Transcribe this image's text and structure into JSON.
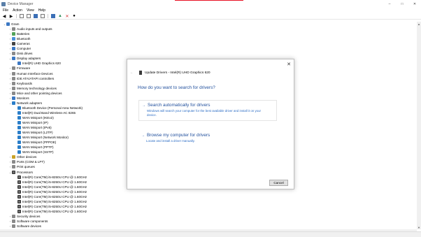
{
  "window": {
    "title": "Device Manager",
    "buttons": {
      "minimize": "–",
      "maximize": "□",
      "close": "✕"
    }
  },
  "menu": [
    "File",
    "Action",
    "View",
    "Help"
  ],
  "toolbar": [
    "back-arrow-icon",
    "forward-arrow-icon",
    "view-icon",
    "properties-icon",
    "help-icon",
    "list-icon",
    "monitor-icon",
    "update-driver-icon",
    "uninstall-icon",
    "scan-hardware-icon"
  ],
  "tree": [
    {
      "label": "Gram",
      "level": 0,
      "exp": "⌄",
      "icon": "computer"
    },
    {
      "label": "Audio inputs and outputs",
      "level": 1,
      "exp": "›",
      "icon": "gray"
    },
    {
      "label": "Batteries",
      "level": 1,
      "exp": "›",
      "icon": "green"
    },
    {
      "label": "Bluetooth",
      "level": 1,
      "exp": "›",
      "icon": "blue"
    },
    {
      "label": "Cameras",
      "level": 1,
      "exp": "›",
      "icon": "dark"
    },
    {
      "label": "Computer",
      "level": 1,
      "exp": "›",
      "icon": "computer"
    },
    {
      "label": "Disk drives",
      "level": 1,
      "exp": "›",
      "icon": "gray"
    },
    {
      "label": "Display adapters",
      "level": 1,
      "exp": "⌄",
      "icon": "computer"
    },
    {
      "label": "Intel(R) UHD Graphics 620",
      "level": 2,
      "exp": "",
      "icon": "computer"
    },
    {
      "label": "Firmware",
      "level": 1,
      "exp": "›",
      "icon": "gray"
    },
    {
      "label": "Human Interface Devices",
      "level": 1,
      "exp": "›",
      "icon": "gray"
    },
    {
      "label": "IDE ATA/ATAPI controllers",
      "level": 1,
      "exp": "›",
      "icon": "gray"
    },
    {
      "label": "Keyboards",
      "level": 1,
      "exp": "›",
      "icon": "gray"
    },
    {
      "label": "Memory technology devices",
      "level": 1,
      "exp": "›",
      "icon": "gray"
    },
    {
      "label": "Mice and other pointing devices",
      "level": 1,
      "exp": "›",
      "icon": "gray"
    },
    {
      "label": "Monitors",
      "level": 1,
      "exp": "›",
      "icon": "computer"
    },
    {
      "label": "Network adapters",
      "level": 1,
      "exp": "⌄",
      "icon": "netw"
    },
    {
      "label": "Bluetooth Device (Personal Area Network)",
      "level": 2,
      "exp": "",
      "icon": "netw"
    },
    {
      "label": "Intel(R) Dual Band Wireless-AC 8265",
      "level": 2,
      "exp": "",
      "icon": "netw"
    },
    {
      "label": "WAN Miniport (IKEv2)",
      "level": 2,
      "exp": "",
      "icon": "netw"
    },
    {
      "label": "WAN Miniport (IP)",
      "level": 2,
      "exp": "",
      "icon": "netw"
    },
    {
      "label": "WAN Miniport (IPv6)",
      "level": 2,
      "exp": "",
      "icon": "netw"
    },
    {
      "label": "WAN Miniport (L2TP)",
      "level": 2,
      "exp": "",
      "icon": "netw"
    },
    {
      "label": "WAN Miniport (Network Monitor)",
      "level": 2,
      "exp": "",
      "icon": "netw"
    },
    {
      "label": "WAN Miniport (PPPOE)",
      "level": 2,
      "exp": "",
      "icon": "netw"
    },
    {
      "label": "WAN Miniport (PPTP)",
      "level": 2,
      "exp": "",
      "icon": "netw"
    },
    {
      "label": "WAN Miniport (SSTP)",
      "level": 2,
      "exp": "",
      "icon": "netw"
    },
    {
      "label": "Other devices",
      "level": 1,
      "exp": "›",
      "icon": "yellow"
    },
    {
      "label": "Ports (COM & LPT)",
      "level": 1,
      "exp": "›",
      "icon": "gray"
    },
    {
      "label": "Print queues",
      "level": 1,
      "exp": "›",
      "icon": "gray"
    },
    {
      "label": "Processors",
      "level": 1,
      "exp": "⌄",
      "icon": "chip"
    },
    {
      "label": "Intel(R) Core(TM) i5-8250U CPU @ 1.60GHz",
      "level": 2,
      "exp": "",
      "icon": "chip"
    },
    {
      "label": "Intel(R) Core(TM) i5-8250U CPU @ 1.60GHz",
      "level": 2,
      "exp": "",
      "icon": "chip"
    },
    {
      "label": "Intel(R) Core(TM) i5-8250U CPU @ 1.60GHz",
      "level": 2,
      "exp": "",
      "icon": "chip"
    },
    {
      "label": "Intel(R) Core(TM) i5-8250U CPU @ 1.60GHz",
      "level": 2,
      "exp": "",
      "icon": "chip"
    },
    {
      "label": "Intel(R) Core(TM) i5-8250U CPU @ 1.60GHz",
      "level": 2,
      "exp": "",
      "icon": "chip"
    },
    {
      "label": "Intel(R) Core(TM) i5-8250U CPU @ 1.60GHz",
      "level": 2,
      "exp": "",
      "icon": "chip"
    },
    {
      "label": "Intel(R) Core(TM) i5-8250U CPU @ 1.60GHz",
      "level": 2,
      "exp": "",
      "icon": "chip"
    },
    {
      "label": "Intel(R) Core(TM) i5-8250U CPU @ 1.60GHz",
      "level": 2,
      "exp": "",
      "icon": "chip"
    },
    {
      "label": "Security devices",
      "level": 1,
      "exp": "›",
      "icon": "gray"
    },
    {
      "label": "Software components",
      "level": 1,
      "exp": "›",
      "icon": "gray"
    },
    {
      "label": "Software devices",
      "level": 1,
      "exp": "›",
      "icon": "gray"
    }
  ],
  "dialog": {
    "back": "←",
    "header": "Update Drivers - Intel(R) UHD Graphics 620",
    "close": "✕",
    "question": "How do you want to search for drivers?",
    "option_auto_title": "Search automatically for drivers",
    "option_auto_desc": "Windows will search your computer for the best available driver and install it on your device.",
    "option_browse_title": "Browse my computer for drivers",
    "option_browse_desc": "Locate and install a driver manually.",
    "cancel": "Cancel",
    "arrow": "→"
  },
  "colors": {
    "link_blue": "#1f4e9c",
    "accent_red": "#e81123"
  }
}
